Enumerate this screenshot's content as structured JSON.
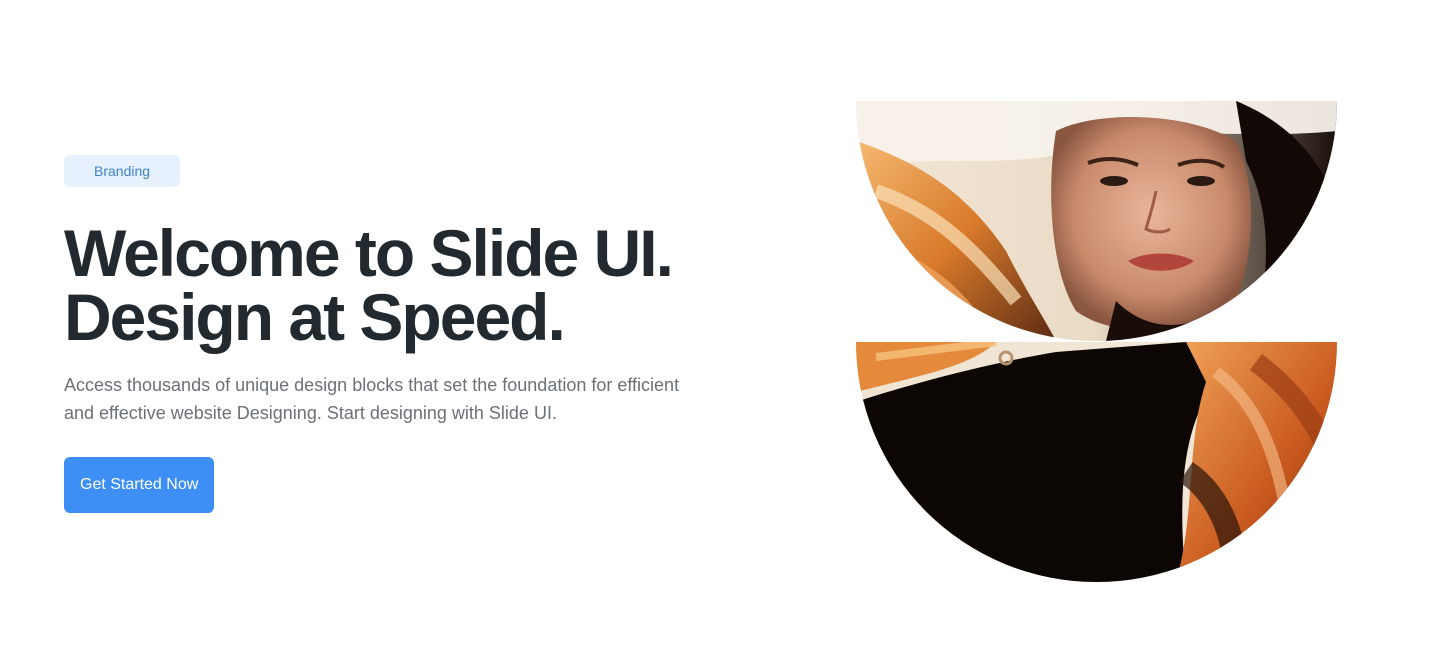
{
  "badge": {
    "label": "Branding"
  },
  "headline": {
    "line1": "Welcome to Slide UI.",
    "line2": "Design at Speed."
  },
  "description": {
    "line1": "Access thousands of unique design blocks that set the foundation for efficient",
    "line2": "and effective website Designing. Start designing with Slide UI."
  },
  "cta": {
    "label": "Get Started Now"
  },
  "hero_image": {
    "icon": "portrait-photo-halves"
  },
  "colors": {
    "badge_bg": "#e6f1fd",
    "badge_text": "#3d84c7",
    "headline": "#222a2f",
    "body_text": "#6b7177",
    "cta_bg": "#3d8ef5"
  }
}
